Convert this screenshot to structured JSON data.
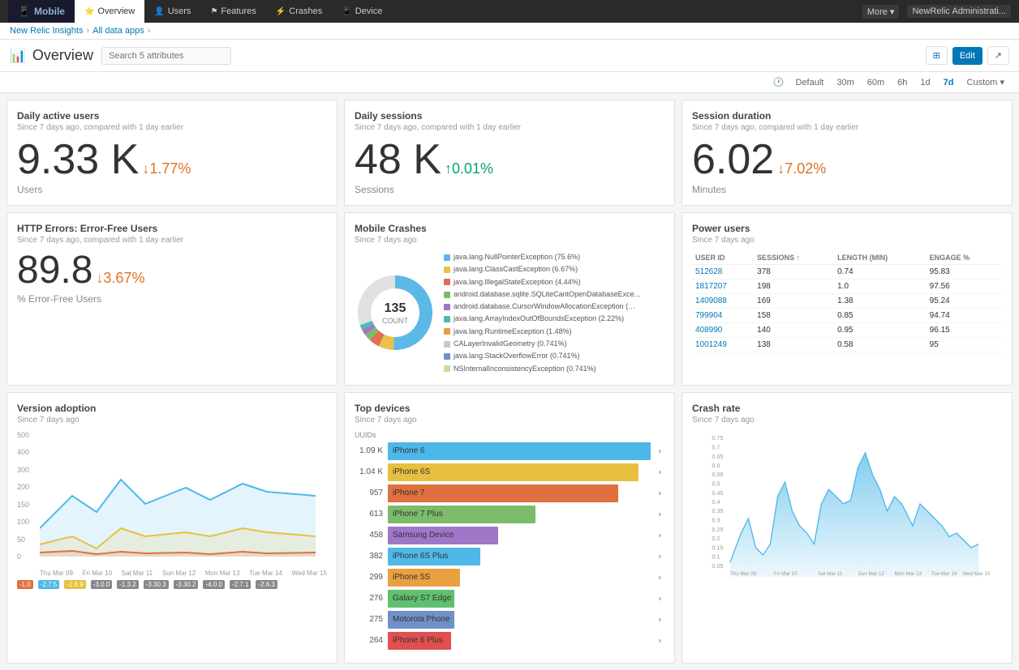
{
  "topNav": {
    "brand": "Mobile",
    "tabs": [
      {
        "label": "Overview",
        "icon": "⭐",
        "active": true
      },
      {
        "label": "Users",
        "icon": "👤"
      },
      {
        "label": "Features",
        "icon": "⚑"
      },
      {
        "label": "Crashes",
        "icon": "⚡"
      },
      {
        "label": "Device",
        "icon": "📱"
      }
    ],
    "rightButtons": [
      "More ▾",
      "NewRelic Administrati..."
    ]
  },
  "breadcrumb": {
    "items": [
      "New Relic Insights",
      "All data apps"
    ]
  },
  "header": {
    "title": "Overview",
    "searchPlaceholder": "Search 5 attributes",
    "buttons": [
      "⊞",
      "Edit",
      "↗"
    ]
  },
  "timeFilters": {
    "clockLabel": "Default",
    "options": [
      "30m",
      "60m",
      "6h",
      "1d",
      "7d",
      "Custom ▾"
    ],
    "active": "7d"
  },
  "dailyActiveUsers": {
    "title": "Daily active users",
    "subtitle": "Since 7 days ago, compared with 1 day earlier",
    "value": "9.33 K",
    "change": "↓1.77%",
    "changeType": "down",
    "unit": "Users"
  },
  "dailySessions": {
    "title": "Daily sessions",
    "subtitle": "Since 7 days ago, compared with 1 day earlier",
    "value": "48 K",
    "change": "↑0.01%",
    "changeType": "up",
    "unit": "Sessions"
  },
  "sessionDuration": {
    "title": "Session duration",
    "subtitle": "Since 7 days ago, compared with 1 day earlier",
    "value": "6.02",
    "change": "↓7.02%",
    "changeType": "down",
    "unit": "Minutes"
  },
  "httpErrors": {
    "title": "HTTP Errors: Error-Free Users",
    "subtitle": "Since 7 days ago, compared with 1 day earlier",
    "value": "89.8",
    "change": "↓3.67%",
    "changeType": "down",
    "unit": "% Error-Free Users"
  },
  "mobileCrashes": {
    "title": "Mobile Crashes",
    "subtitle": "Since 7 days ago",
    "totalCount": "135",
    "countLabel": "COUNT",
    "legend": [
      {
        "color": "#5cb8e6",
        "label": "java.lang.NullPointerException (75.6%)"
      },
      {
        "color": "#e8c24a",
        "label": "java.lang.ClassCastException (6.67%)"
      },
      {
        "color": "#e07050",
        "label": "java.lang.IllegalStateException (4.44%)"
      },
      {
        "color": "#7cbb6a",
        "label": "android.database.sqlite.SQLiteCantOpenDatabaseExce..."
      },
      {
        "color": "#a076c8",
        "label": "android.database.CursorWindowAllocationException (…"
      },
      {
        "color": "#50b8b0",
        "label": "java.lang.ArrayIndexOutOfBoundsException (2.22%)"
      },
      {
        "color": "#e8a040",
        "label": "java.lang.RuntimeException (1.48%)"
      },
      {
        "color": "#c8c8c8",
        "label": "CALayerInvalidGeometry (0.741%)"
      },
      {
        "color": "#7090c8",
        "label": "java.lang.StackOverflowError (0.741%)"
      },
      {
        "color": "#d0d8a0",
        "label": "NSInternalInconsistencyException (0.741%)"
      }
    ]
  },
  "powerUsers": {
    "title": "Power users",
    "subtitle": "Since 7 days ago",
    "columns": [
      "USER ID",
      "SESSIONS ↑",
      "LENGTH (MIN)",
      "ENGAGE %"
    ],
    "rows": [
      {
        "userId": "512628",
        "sessions": "378",
        "length": "0.74",
        "engage": "95.83"
      },
      {
        "userId": "1817207",
        "sessions": "198",
        "length": "1.0",
        "engage": "97.56"
      },
      {
        "userId": "1409088",
        "sessions": "169",
        "length": "1.38",
        "engage": "95.24"
      },
      {
        "userId": "799904",
        "sessions": "158",
        "length": "0.85",
        "engage": "94.74"
      },
      {
        "userId": "408990",
        "sessions": "140",
        "length": "0.95",
        "engage": "96.15"
      },
      {
        "userId": "1001249",
        "sessions": "138",
        "length": "0.58",
        "engage": "95"
      }
    ]
  },
  "versionAdoption": {
    "title": "Version adoption",
    "subtitle": "Since 7 days ago",
    "yLabels": [
      "500",
      "400",
      "300",
      "200",
      "150",
      "100",
      "50",
      "0"
    ],
    "xLabels": [
      "Thu Mar 09",
      "Fri Mar 10",
      "Sat Mar 11",
      "Sun Mar 12",
      "Mon Mar 13",
      "Tue Mar 14",
      "Wed Mar 15"
    ],
    "colors": [
      "#4db8e8",
      "#e8c040",
      "#e07040"
    ],
    "bottomTicks": [
      "-1.0",
      "-2.7.5",
      "-1.6.9",
      "-3.0.0",
      "-1.3.2",
      "-3.30.3",
      "-3.30.2",
      "-4.0.0",
      "-2.7.1",
      "-2.6.3"
    ]
  },
  "topDevices": {
    "title": "Top devices",
    "subtitle": "Since 7 days ago",
    "unitLabel": "UUIDs",
    "devices": [
      {
        "count": "1.09 K",
        "name": "iPhone 6",
        "barWidth": "95",
        "color": "#4db8e8"
      },
      {
        "count": "1.04 K",
        "name": "iPhone 6S",
        "barWidth": "90",
        "color": "#e8c040"
      },
      {
        "count": "957",
        "name": "iPhone 7",
        "barWidth": "82",
        "color": "#e07040"
      },
      {
        "count": "613",
        "name": "iPhone 7 Plus",
        "barWidth": "54",
        "color": "#7cbb6a"
      },
      {
        "count": "458",
        "name": "Samsung Device",
        "barWidth": "42",
        "color": "#a076c8"
      },
      {
        "count": "382",
        "name": "iPhone 6S Plus",
        "barWidth": "35",
        "color": "#50b8e8"
      },
      {
        "count": "299",
        "name": "iPhone 5S",
        "barWidth": "28",
        "color": "#e8a040"
      },
      {
        "count": "276",
        "name": "Galaxy S7 Edge",
        "barWidth": "26",
        "color": "#60c070"
      },
      {
        "count": "275",
        "name": "Motorola Phone",
        "barWidth": "25",
        "color": "#7090c8"
      },
      {
        "count": "264",
        "name": "iPhone 6 Plus",
        "barWidth": "25",
        "color": "#e05050"
      }
    ]
  },
  "crashRate": {
    "title": "Crash rate",
    "subtitle": "Since 7 days ago",
    "yLabels": [
      "0.75",
      "0.7",
      "0.65",
      "0.6",
      "0.55",
      "0.5",
      "0.45",
      "0.4",
      "0.35",
      "0.3",
      "0.25",
      "0.2",
      "0.15",
      "0.1",
      "0.05"
    ],
    "xLabels": [
      "Thu Mar 09",
      "Fri Mar 10",
      "Sat Mar 11",
      "Sun Mar 12",
      "Mon Mar 13",
      "Tue Mar 14",
      "Wed Mar 15"
    ]
  }
}
